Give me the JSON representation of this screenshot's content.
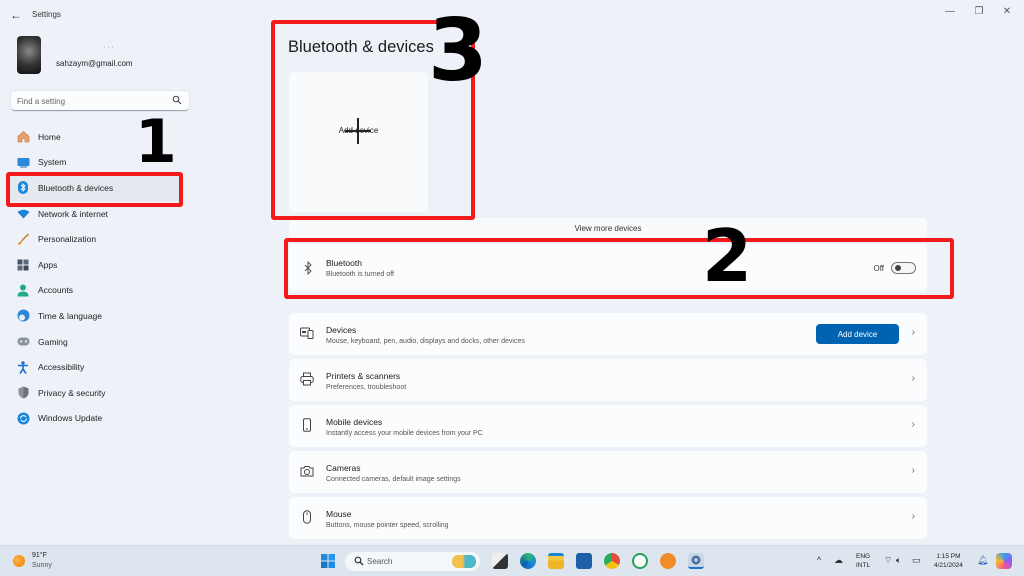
{
  "window": {
    "title": "Settings",
    "back_icon": "arrow-left-icon",
    "controls": {
      "minimize": "—",
      "maximize": "❐",
      "close": "✕"
    }
  },
  "profile": {
    "name_hidden": "· · ·",
    "email": "sahzaym@gmail.com"
  },
  "search": {
    "placeholder": "Find a setting",
    "value": ""
  },
  "sidebar": {
    "items": [
      {
        "label": "Home",
        "icon": "home-icon",
        "color": "#e07a3c"
      },
      {
        "label": "System",
        "icon": "system-icon",
        "color": "#2b88d8"
      },
      {
        "label": "Bluetooth & devices",
        "icon": "bluetooth-icon",
        "color": "#1a86d9",
        "active": true
      },
      {
        "label": "Network & internet",
        "icon": "wifi-icon",
        "color": "#1a86d9"
      },
      {
        "label": "Personalization",
        "icon": "brush-icon",
        "color": "#e0932f"
      },
      {
        "label": "Apps",
        "icon": "apps-icon",
        "color": "#445566"
      },
      {
        "label": "Accounts",
        "icon": "accounts-icon",
        "color": "#23a886"
      },
      {
        "label": "Time & language",
        "icon": "globe-clock-icon",
        "color": "#2b88d8"
      },
      {
        "label": "Gaming",
        "icon": "gamepad-icon",
        "color": "#7a8590"
      },
      {
        "label": "Accessibility",
        "icon": "accessibility-icon",
        "color": "#1a6fd1"
      },
      {
        "label": "Privacy & security",
        "icon": "shield-icon",
        "color": "#8a939c"
      },
      {
        "label": "Windows Update",
        "icon": "update-icon",
        "color": "#1a86d9"
      }
    ]
  },
  "main": {
    "title": "Bluetooth & devices",
    "add_tile_label": "Add device",
    "view_more": "View more devices",
    "bluetooth": {
      "title": "Bluetooth",
      "subtitle": "Bluetooth is turned off",
      "state_label": "Off",
      "enabled": false
    },
    "cards": [
      {
        "title": "Devices",
        "subtitle": "Mouse, keyboard, pen, audio, displays and docks, other devices",
        "icon": "devices-icon",
        "button": "Add device"
      },
      {
        "title": "Printers & scanners",
        "subtitle": "Preferences, troubleshoot",
        "icon": "printer-icon"
      },
      {
        "title": "Mobile devices",
        "subtitle": "Instantly access your mobile devices from your PC",
        "icon": "phone-icon"
      },
      {
        "title": "Cameras",
        "subtitle": "Connected cameras, default image settings",
        "icon": "camera-icon"
      },
      {
        "title": "Mouse",
        "subtitle": "Buttons, mouse pointer speed, scrolling",
        "icon": "mouse-icon"
      }
    ],
    "chevron": "›"
  },
  "annotations": {
    "one": "1",
    "two": "2",
    "three": "3",
    "color": "#f21a1a"
  },
  "taskbar": {
    "weather": {
      "temp": "91°F",
      "condition": "Sunny"
    },
    "search_label": "Search",
    "language": {
      "line1": "ENG",
      "line2": "INTL"
    },
    "clock": {
      "time": "1:15 PM",
      "date": "4/21/2024"
    },
    "tray_chevron": "^"
  }
}
